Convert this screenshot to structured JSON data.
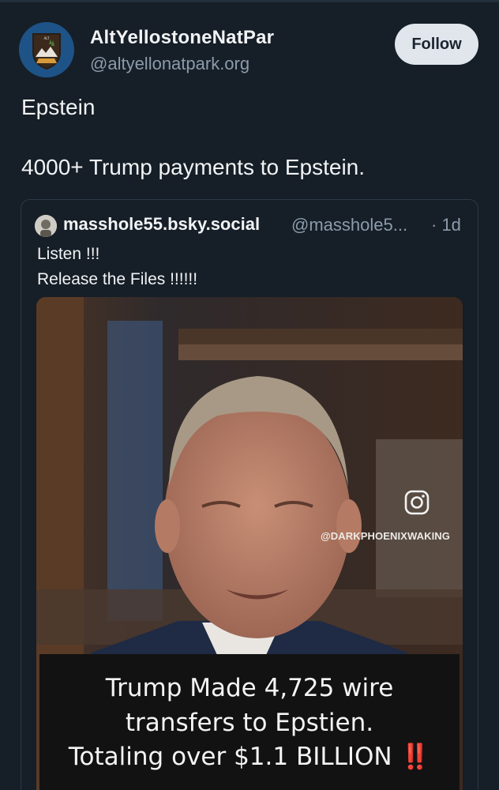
{
  "author": {
    "display_name": "AltYellostoneNatPar",
    "handle": "@altyellonatpark.org",
    "avatar_icon": "park-badge-icon"
  },
  "follow_button": {
    "label": "Follow"
  },
  "post": {
    "line1": "Epstein",
    "line2": "4000+ Trump payments to Epstein."
  },
  "quote": {
    "author_name": "masshole55.bsky.social",
    "author_handle": "@masshole5...",
    "time": "· 1d",
    "text_line1": "Listen !!!",
    "text_line2": "Release the Files !!!!!!",
    "video": {
      "watermark": "@DARKPHOENIXWAKING",
      "caption_line1": "Trump Made 4,725 wire",
      "caption_line2": "transfers to Epstien.",
      "caption_line3": "Totaling over $1.1 BILLION",
      "caption_emoji": "‼️"
    }
  },
  "colors": {
    "background": "#161e27",
    "muted_text": "#8c9bab",
    "follow_bg": "#e0e6eb"
  }
}
